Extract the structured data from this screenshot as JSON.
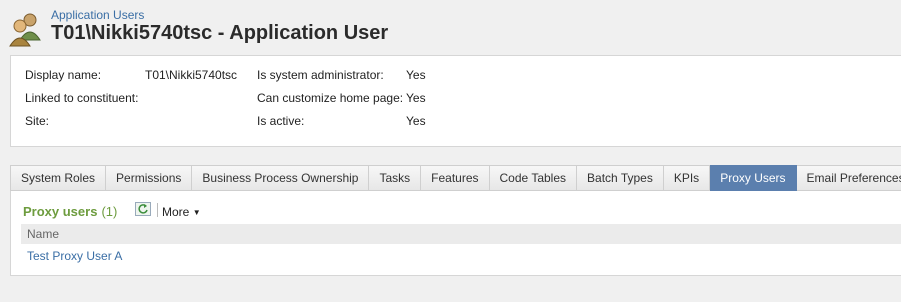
{
  "header": {
    "breadcrumb": "Application Users",
    "title": "T01\\Nikki5740tsc - Application User",
    "icon": "users-icon"
  },
  "summary": {
    "display_name_label": "Display name:",
    "display_name_value": "T01\\Nikki5740tsc",
    "linked_constituent_label": "Linked to constituent:",
    "site_label": "Site:",
    "sysadmin_label": "Is system administrator:",
    "sysadmin_value": "Yes",
    "customize_label": "Can customize home page:",
    "customize_value": "Yes",
    "active_label": "Is active:",
    "active_value": "Yes"
  },
  "tabs": [
    {
      "label": "System Roles"
    },
    {
      "label": "Permissions"
    },
    {
      "label": "Business Process Ownership"
    },
    {
      "label": "Tasks"
    },
    {
      "label": "Features"
    },
    {
      "label": "Code Tables"
    },
    {
      "label": "Batch Types"
    },
    {
      "label": "KPIs"
    },
    {
      "label": "Proxy Users",
      "active": true
    },
    {
      "label": "Email Preferences"
    }
  ],
  "proxy_section": {
    "title": "Proxy users",
    "count": "(1)",
    "more_label": "More",
    "column_name": "Name",
    "rows": [
      {
        "name": "Test Proxy User A"
      }
    ]
  },
  "colors": {
    "link": "#3a6ea5",
    "active_tab": "#5b7fae",
    "section_title": "#6d9c3e"
  }
}
